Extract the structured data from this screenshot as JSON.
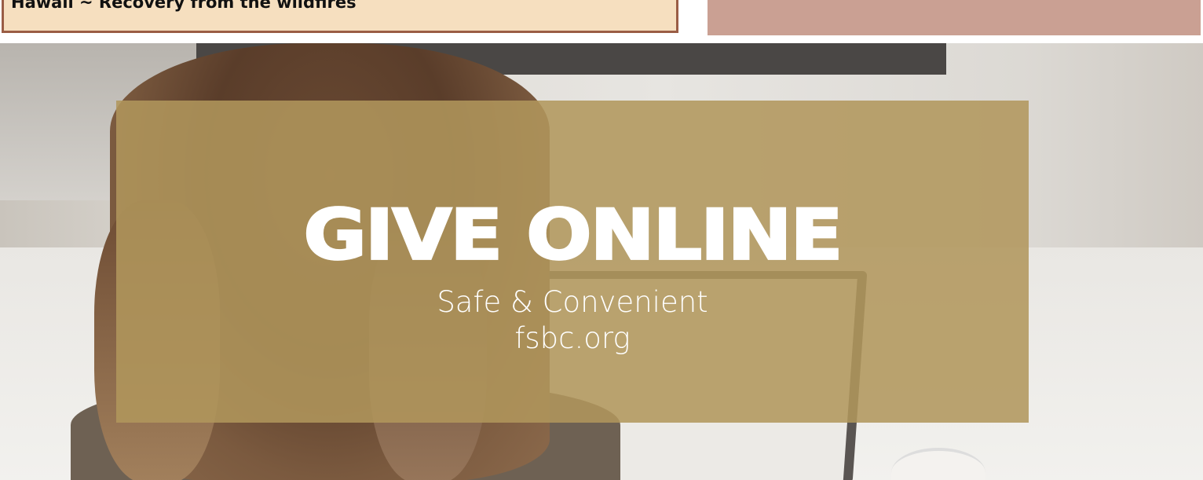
{
  "header": {
    "left_title": "Hawaii ~ Recovery from the wildfires"
  },
  "banner": {
    "headline": "GIVE ONLINE",
    "tagline": "Safe & Convenient",
    "website": "fsbc.org",
    "overlay_color": "#b1965c"
  },
  "colors": {
    "left_box_bg": "#f6dfbf",
    "left_box_border": "#9a5d45",
    "right_box_bg": "#caa093"
  }
}
